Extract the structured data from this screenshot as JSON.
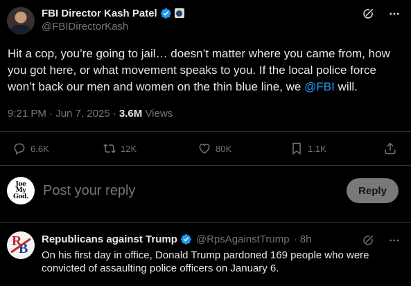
{
  "main_tweet": {
    "display_name": "FBI Director Kash Patel",
    "handle": "@FBIDirectorKash",
    "text_before": "Hit a cop, you’re going to jail… doesn’t matter where  you came from, how you got here, or what movement speaks to you. If the local police force won’t back our men and women on the thin blue line, we ",
    "mention": "@FBI",
    "text_after": " will.",
    "timestamp": "9:21 PM · Jun 7, 2025 · ",
    "views_count": "3.6M",
    "views_label": " Views",
    "actions": {
      "replies": "6.6K",
      "reposts": "12K",
      "likes": "80K",
      "bookmarks": "1.1K"
    }
  },
  "reply_composer": {
    "avatar_text_1": "Joe",
    "avatar_text_2": "My",
    "avatar_text_3": "God.",
    "placeholder": "Post your reply",
    "button_label": "Reply"
  },
  "reply_tweet": {
    "display_name": "Republicans against Trump",
    "handle": "@RpsAgainstTrump",
    "time": "· 8h",
    "avatar_letters_1": "R",
    "avatar_letters_2": "B",
    "text": "On his first day in office, Donald Trump pardoned 169 people who were convicted of assaulting police officers on January 6."
  },
  "colors": {
    "background": "#000000",
    "text_primary": "#e7e9ea",
    "text_secondary": "#71767b",
    "link": "#1d9bf0",
    "verified": "#1d9bf0",
    "divider": "#2f3336",
    "reply_button_bg": "#787a7a"
  },
  "icons": [
    "grok-icon",
    "more-icon",
    "reply-icon",
    "repost-icon",
    "like-icon",
    "bookmark-icon",
    "share-icon",
    "verified-icon",
    "government-badge-icon"
  ]
}
